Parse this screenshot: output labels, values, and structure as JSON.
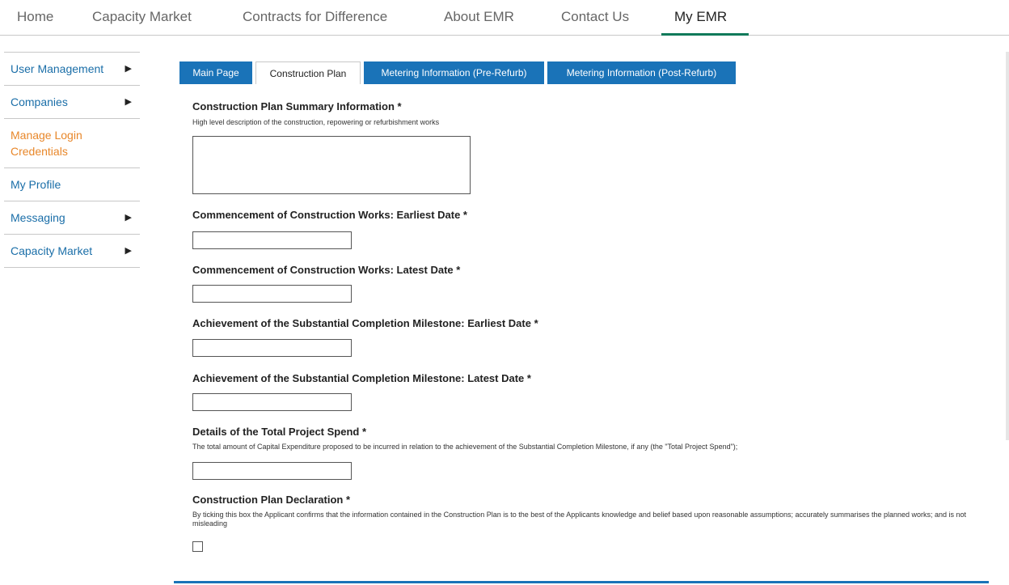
{
  "topnav": {
    "items": [
      "Home",
      "Capacity Market",
      "Contracts for Difference",
      "About EMR",
      "Contact Us",
      "My EMR"
    ]
  },
  "sidebar": {
    "items": [
      {
        "label": "User Management",
        "arrow": "▶"
      },
      {
        "label": "Companies",
        "arrow": "▶"
      },
      {
        "label": "Manage Login Credentials",
        "arrow": ""
      },
      {
        "label": "My Profile",
        "arrow": ""
      },
      {
        "label": "Messaging",
        "arrow": "▶"
      },
      {
        "label": "Capacity Market",
        "arrow": "▶"
      }
    ]
  },
  "tabs": [
    "Main Page",
    "Construction Plan",
    "Metering Information (Pre-Refurb)",
    "Metering Information (Post-Refurb)"
  ],
  "form": {
    "summary_label": "Construction Plan Summary Information *",
    "summary_help": "High level description of the construction, repowering or refurbishment works",
    "summary_value": "",
    "commence_earliest_label": "Commencement of Construction Works: Earliest Date *",
    "commence_earliest_value": "",
    "commence_latest_label": "Commencement of Construction Works: Latest Date *",
    "commence_latest_value": "",
    "milestone_earliest_label": "Achievement of the Substantial Completion Milestone: Earliest Date *",
    "milestone_earliest_value": "",
    "milestone_latest_label": "Achievement of the Substantial Completion Milestone: Latest Date *",
    "milestone_latest_value": "",
    "spend_label": "Details of the Total Project Spend *",
    "spend_help": "The total amount of Capital Expenditure proposed to be incurred in relation to the achievement of the Substantial Completion Milestone, if any (the \"Total Project Spend\");",
    "spend_value": "",
    "declaration_label": "Construction Plan Declaration *",
    "declaration_help": "By ticking this box the Applicant confirms that the information contained in the Construction Plan is to the best of the Applicants knowledge and belief based upon reasonable assumptions; accurately summarises the planned works; and is not misleading",
    "declaration_checked": false
  },
  "colors": {
    "tab_blue": "#1a73b8",
    "link_blue": "#1a6ea8",
    "link_orange": "#e8872a",
    "nav_active_underline": "#0f7a5a"
  }
}
